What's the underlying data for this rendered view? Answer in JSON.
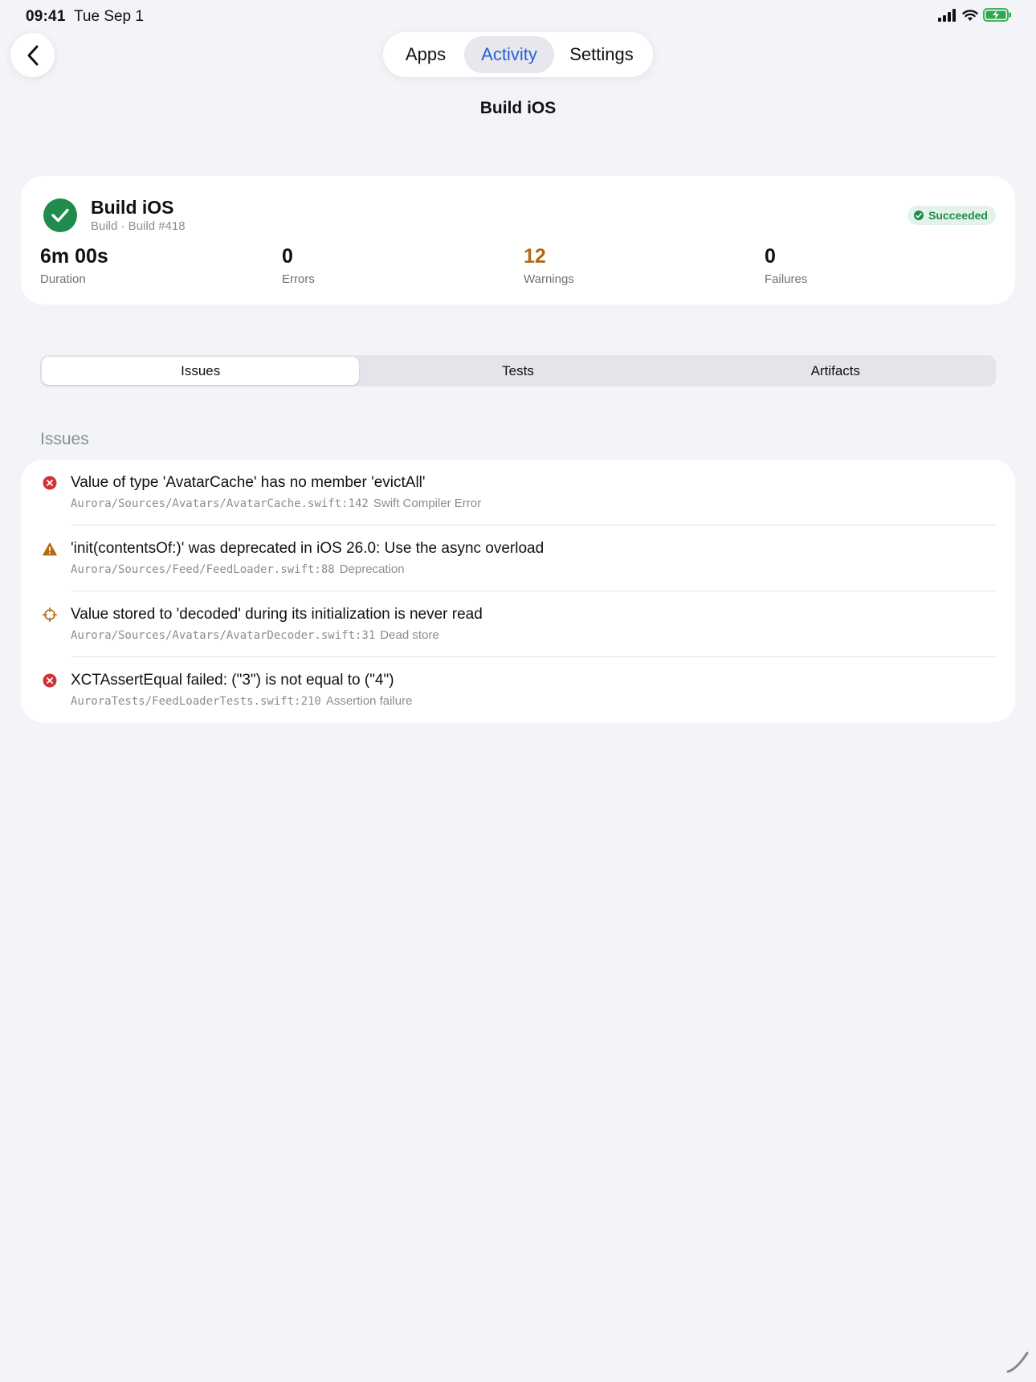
{
  "status_bar": {
    "time": "09:41",
    "date": "Tue Sep 1"
  },
  "top_tabs": {
    "apps": "Apps",
    "activity": "Activity",
    "settings": "Settings",
    "selected": "Activity"
  },
  "nav": {
    "title": "Build iOS"
  },
  "summary": {
    "title": "Build iOS",
    "subtitle": "Build · Build #418",
    "status": "Succeeded",
    "metrics": [
      {
        "value": "6m 00s",
        "label": "Duration"
      },
      {
        "value": "0",
        "label": "Errors"
      },
      {
        "value": "12",
        "label": "Warnings"
      },
      {
        "value": "0",
        "label": "Failures"
      }
    ]
  },
  "segments": {
    "issues": "Issues",
    "tests": "Tests",
    "artifacts": "Artifacts",
    "selected": "Issues"
  },
  "issues_section": {
    "header": "Issues"
  },
  "issues": [
    {
      "severity": "error",
      "icon": "error-icon",
      "title": "Value of type 'AvatarCache' has no member 'evictAll'",
      "path": "Aurora/Sources/Avatars/AvatarCache.swift:142",
      "kind": "Swift Compiler Error"
    },
    {
      "severity": "warning",
      "icon": "warning-icon",
      "title": "'init(contentsOf:)' was deprecated in iOS 26.0: Use the async overload",
      "path": "Aurora/Sources/Feed/FeedLoader.swift:88",
      "kind": "Deprecation"
    },
    {
      "severity": "analyzer",
      "icon": "crosshair-icon",
      "title": "Value stored to 'decoded' during its initialization is never read",
      "path": "Aurora/Sources/Avatars/AvatarDecoder.swift:31",
      "kind": "Dead store"
    },
    {
      "severity": "error",
      "icon": "error-icon",
      "title": "XCTAssertEqual failed: (\"3\") is not equal to (\"4\")",
      "path": "AuroraTests/FeedLoaderTests.swift:210",
      "kind": "Assertion failure"
    }
  ],
  "colors": {
    "accent": "#2a5fd6",
    "success": "#1f8b4c",
    "warning": "#b36a12",
    "error": "#d0323a",
    "background": "#f2f4f8"
  }
}
